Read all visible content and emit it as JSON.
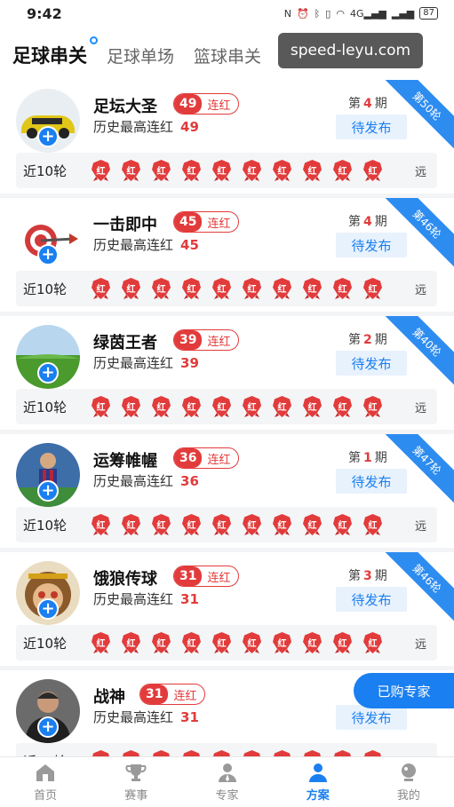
{
  "status_bar": {
    "time": "9:42",
    "network": "4G",
    "battery": "87"
  },
  "top_tabs": [
    {
      "label": "足球串关",
      "active": true
    },
    {
      "label": "足球单场",
      "active": false
    },
    {
      "label": "篮球串关",
      "active": false
    }
  ],
  "watermark": "speed-leyu.com",
  "common": {
    "streak_suffix": "连红",
    "history_label": "历史最高连红",
    "period_prefix": "第",
    "period_suffix": "期",
    "pending_label": "待发布",
    "recent_label": "近10轮",
    "badge_text": "红",
    "far_label": "远"
  },
  "experts": [
    {
      "name": "足坛大圣",
      "streak": "49",
      "history": "49",
      "period": "4",
      "ribbon": "第50轮",
      "avatar": "car"
    },
    {
      "name": "一击即中",
      "streak": "45",
      "history": "45",
      "period": "4",
      "ribbon": "第46轮",
      "avatar": "dart"
    },
    {
      "name": "绿茵王者",
      "streak": "39",
      "history": "39",
      "period": "2",
      "ribbon": "第40轮",
      "avatar": "grass"
    },
    {
      "name": "运筹帷幄",
      "streak": "36",
      "history": "36",
      "period": "1",
      "ribbon": "第47轮",
      "avatar": "player"
    },
    {
      "name": "饿狼传球",
      "streak": "31",
      "history": "31",
      "period": "3",
      "ribbon": "第46轮",
      "avatar": "monkey"
    },
    {
      "name": "战神",
      "streak": "31",
      "history": "31",
      "period": "",
      "ribbon": "",
      "avatar": "man"
    }
  ],
  "bought_experts_button": "已购专家",
  "bottom_nav": [
    {
      "label": "首页",
      "icon": "home-icon",
      "active": false
    },
    {
      "label": "赛事",
      "icon": "trophy-icon",
      "active": false
    },
    {
      "label": "专家",
      "icon": "expert-icon",
      "active": false
    },
    {
      "label": "方案",
      "icon": "plan-icon",
      "active": true
    },
    {
      "label": "我的",
      "icon": "profile-icon",
      "active": false
    }
  ],
  "colors": {
    "accent": "#1a7ff0",
    "red": "#e23b3b",
    "ribbon": "#2d8cf0"
  }
}
